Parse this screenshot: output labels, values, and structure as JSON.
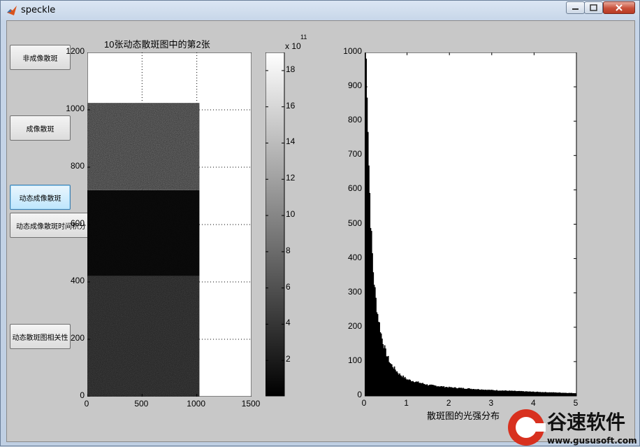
{
  "window": {
    "title": "speckle"
  },
  "buttons": {
    "b1": "非成像散斑",
    "b2": "成像散斑",
    "b3": "动态成像散斑",
    "b4": "动态成像散斑时间积分",
    "b5": "动态散斑图相关性"
  },
  "left_plot": {
    "title": "10张动态散斑图中的第2张",
    "xticks": [
      "0",
      "500",
      "1000",
      "1500"
    ],
    "yticks": [
      "0",
      "200",
      "400",
      "600",
      "800",
      "1000",
      "1200"
    ]
  },
  "colorbar": {
    "exponent_base": "x 10",
    "exponent_power": "11",
    "ticks": [
      "2",
      "4",
      "6",
      "8",
      "10",
      "12",
      "14",
      "16",
      "18"
    ]
  },
  "right_plot": {
    "xlabel": "散斑图的光强分布",
    "xticks": [
      "0",
      "1",
      "2",
      "3",
      "4",
      "5"
    ],
    "yticks": [
      "0",
      "100",
      "200",
      "300",
      "400",
      "500",
      "600",
      "700",
      "800",
      "900",
      "1000"
    ]
  },
  "chart_data": [
    {
      "type": "heatmap",
      "title": "10张动态散斑图中的第2张",
      "xlim": [
        0,
        1500
      ],
      "ylim": [
        0,
        1200
      ],
      "colormap": "gray",
      "colorbar_range": [
        0,
        19
      ],
      "colorbar_exponent": 11,
      "image_extent": {
        "x": [
          0,
          1024
        ],
        "y": [
          0,
          1024
        ]
      },
      "bands": [
        {
          "y_range": [
            0,
            420
          ],
          "brightness": "dark speckle"
        },
        {
          "y_range": [
            420,
            720
          ],
          "brightness": "near black"
        },
        {
          "y_range": [
            720,
            1024
          ],
          "brightness": "bright speckle"
        }
      ]
    },
    {
      "type": "bar",
      "xlabel": "散斑图的光强分布",
      "xlim": [
        0,
        5
      ],
      "ylim": [
        0,
        1000
      ],
      "x": [
        0.02,
        0.05,
        0.1,
        0.15,
        0.2,
        0.25,
        0.3,
        0.4,
        0.5,
        0.6,
        0.8,
        1.0,
        1.5,
        2.0,
        3.0,
        4.0,
        5.0
      ],
      "values": [
        1000,
        930,
        640,
        470,
        360,
        290,
        240,
        170,
        125,
        95,
        65,
        48,
        32,
        25,
        17,
        12,
        8
      ]
    }
  ]
}
